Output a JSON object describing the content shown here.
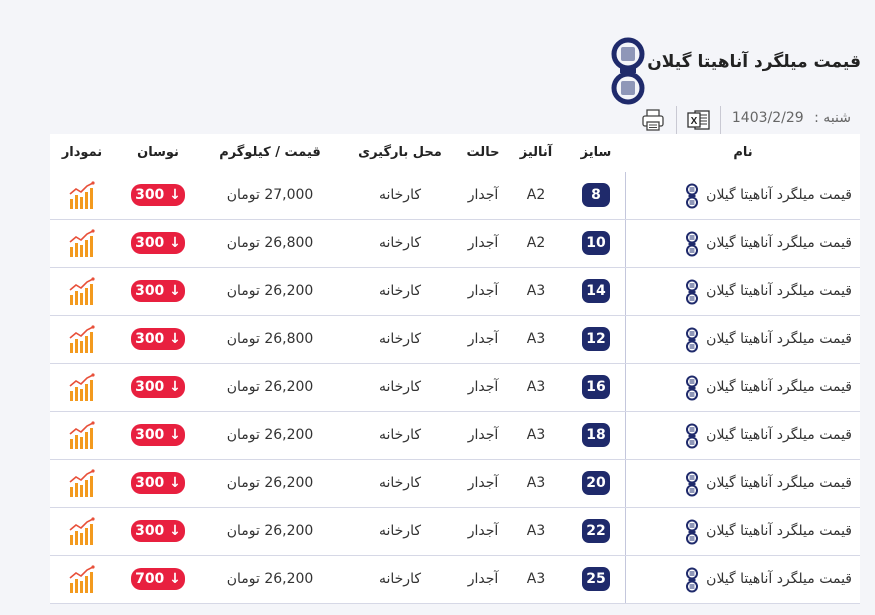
{
  "header": {
    "title": "قیمت میلگرد آناهیتا گیلان",
    "date_label": "شنبه :",
    "date_value": "1403/2/29",
    "excel_letter": "X"
  },
  "columns": {
    "name": "نام",
    "size": "سایز",
    "analysis": "آنالیز",
    "state": "حالت",
    "location": "محل بارگیری",
    "price": "قیمت / کیلوگرم",
    "change": "نوسان",
    "chart": "نمودار"
  },
  "colors": {
    "navy": "#1f2a6b",
    "red": "#e8203f",
    "orange": "#f39a1e"
  },
  "rows": [
    {
      "name": "قیمت میلگرد آناهیتا گیلان",
      "size": "8",
      "analysis": "A2",
      "state": "آجدار",
      "location": "کارخانه",
      "price": "27,000 تومان",
      "change": "300 ↓"
    },
    {
      "name": "قیمت میلگرد آناهیتا گیلان",
      "size": "10",
      "analysis": "A2",
      "state": "آجدار",
      "location": "کارخانه",
      "price": "26,800 تومان",
      "change": "300 ↓"
    },
    {
      "name": "قیمت میلگرد آناهیتا گیلان",
      "size": "14",
      "analysis": "A3",
      "state": "آجدار",
      "location": "کارخانه",
      "price": "26,200 تومان",
      "change": "300 ↓"
    },
    {
      "name": "قیمت میلگرد آناهیتا گیلان",
      "size": "12",
      "analysis": "A3",
      "state": "آجدار",
      "location": "کارخانه",
      "price": "26,800 تومان",
      "change": "300 ↓"
    },
    {
      "name": "قیمت میلگرد آناهیتا گیلان",
      "size": "16",
      "analysis": "A3",
      "state": "آجدار",
      "location": "کارخانه",
      "price": "26,200 تومان",
      "change": "300 ↓"
    },
    {
      "name": "قیمت میلگرد آناهیتا گیلان",
      "size": "18",
      "analysis": "A3",
      "state": "آجدار",
      "location": "کارخانه",
      "price": "26,200 تومان",
      "change": "300 ↓"
    },
    {
      "name": "قیمت میلگرد آناهیتا گیلان",
      "size": "20",
      "analysis": "A3",
      "state": "آجدار",
      "location": "کارخانه",
      "price": "26,200 تومان",
      "change": "300 ↓"
    },
    {
      "name": "قیمت میلگرد آناهیتا گیلان",
      "size": "22",
      "analysis": "A3",
      "state": "آجدار",
      "location": "کارخانه",
      "price": "26,200 تومان",
      "change": "300 ↓"
    },
    {
      "name": "قیمت میلگرد آناهیتا گیلان",
      "size": "25",
      "analysis": "A3",
      "state": "آجدار",
      "location": "کارخانه",
      "price": "26,200 تومان",
      "change": "700 ↓"
    }
  ]
}
